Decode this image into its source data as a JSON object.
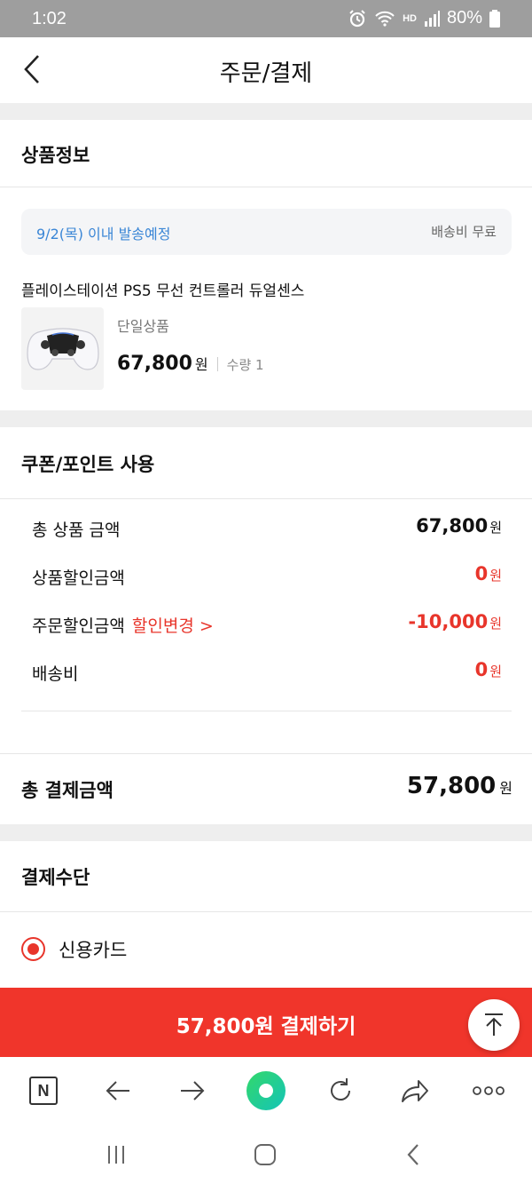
{
  "status": {
    "time": "1:02",
    "hd_label": "HD",
    "battery": "80%"
  },
  "header": {
    "title": "주문/결제"
  },
  "product_section": {
    "title": "상품정보",
    "ship_date": "9/2(목) 이내 발송예정",
    "ship_fee": "배송비 무료",
    "product_name": "플레이스테이션 PS5 무선 컨트롤러 듀얼센스",
    "option": "단일상품",
    "price": "67,800",
    "price_unit": "원",
    "quantity": "수량 1"
  },
  "coupon_section": {
    "title": "쿠폰/포인트 사용",
    "rows": [
      {
        "label": "총 상품 금액",
        "value": "67,800",
        "unit": "원"
      },
      {
        "label": "상품할인금액",
        "value": "0",
        "unit": "원"
      },
      {
        "label": "주문할인금액",
        "link": "할인변경 >",
        "value": "-10,000",
        "unit": "원"
      },
      {
        "label": "배송비",
        "value": "0",
        "unit": "원"
      }
    ]
  },
  "total": {
    "label": "총 결제금액",
    "value": "57,800",
    "unit": "원"
  },
  "payment_section": {
    "title": "결제수단",
    "method": "신용카드"
  },
  "pay_button": {
    "label": "57,800원 결제하기"
  },
  "colors": {
    "accent": "#e8352b",
    "pay_bar": "#f0352b",
    "ship_date": "#3a86d6"
  },
  "icons": [
    "back-icon",
    "controller-icon",
    "scroll-top-icon",
    "naver-icon",
    "back-arrow-icon",
    "forward-arrow-icon",
    "home-ball-icon",
    "refresh-icon",
    "share-icon",
    "more-icon",
    "recent-apps-icon",
    "home-icon",
    "nav-back-icon"
  ]
}
